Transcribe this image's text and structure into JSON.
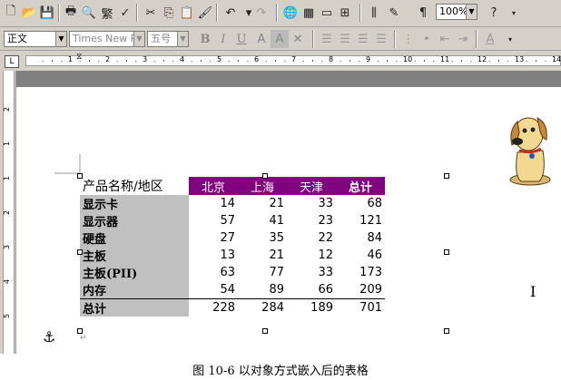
{
  "toolbar": {
    "zoom": "100%",
    "style": "正文",
    "font": "Times New Ro",
    "size": "五号",
    "bold": "B",
    "italic": "I",
    "underline": "U",
    "font_color_glyph": "A",
    "shading_glyph": "A"
  },
  "table": {
    "corner_label": "产品名称/地区",
    "columns": [
      "北京",
      "上海",
      "天津",
      "总计"
    ],
    "rows": [
      {
        "name": "显示卡",
        "values": [
          "14",
          "21",
          "33",
          "68"
        ]
      },
      {
        "name": "显示器",
        "values": [
          "57",
          "41",
          "23",
          "121"
        ]
      },
      {
        "name": "硬盘",
        "values": [
          "27",
          "35",
          "22",
          "84"
        ]
      },
      {
        "name": "主板",
        "values": [
          "13",
          "21",
          "12",
          "46"
        ]
      },
      {
        "name": "主板(PII)",
        "values": [
          "63",
          "77",
          "33",
          "173"
        ]
      },
      {
        "name": "内存",
        "values": [
          "54",
          "89",
          "66",
          "209"
        ]
      }
    ],
    "total": {
      "name": "总计",
      "values": [
        "228",
        "284",
        "189",
        "701"
      ]
    }
  },
  "ruler_numbers": [
    "1",
    "2",
    "3",
    "4",
    "5",
    "6",
    "7",
    "8",
    "9",
    "10",
    "11",
    "12",
    "13",
    "14"
  ],
  "vruler_numbers": [
    "2",
    "1",
    "1",
    "2",
    "3",
    "4",
    "5"
  ],
  "caption": "图 10-6  以对象方式嵌入后的表格",
  "colors": {
    "header_bg": "#800080",
    "row_header_bg": "#c0c0c0",
    "toolbar_bg": "#d4d0c8"
  }
}
